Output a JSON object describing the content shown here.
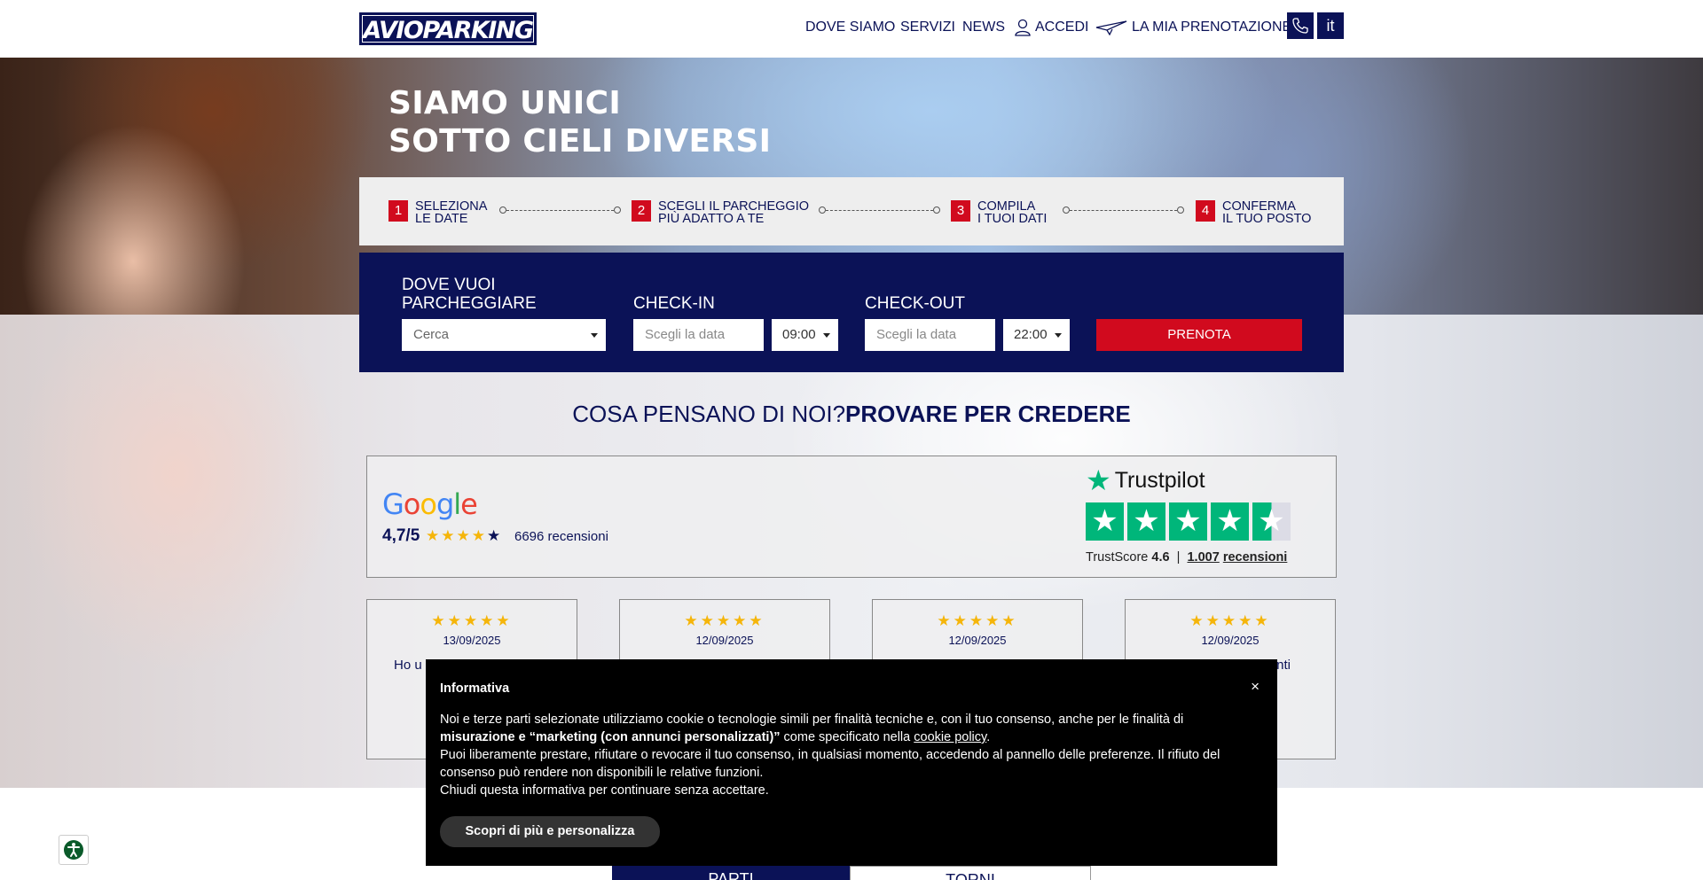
{
  "header": {
    "logo_text": "AVIOPARKING",
    "nav": {
      "where": "DOVE SIAMO",
      "services": "SERVIZI",
      "news": "NEWS",
      "login": "ACCEDI",
      "my_booking": "LA MIA PRENOTAZIONE"
    },
    "language": "it"
  },
  "hero": {
    "title_line1": "SIAMO UNICI",
    "title_line2": "SOTTO CIELI DIVERSI"
  },
  "steps": [
    {
      "num": "1",
      "line1": "SELEZIONA",
      "line2": "LE DATE"
    },
    {
      "num": "2",
      "line1": "SCEGLI IL PARCHEGGIO",
      "line2": "PIÙ ADATTO A TE"
    },
    {
      "num": "3",
      "line1": "COMPILA",
      "line2": "I TUOI DATI"
    },
    {
      "num": "4",
      "line1": "CONFERMA",
      "line2": "IL TUO POSTO"
    }
  ],
  "booking": {
    "where_label_line1": "DOVE VUOI",
    "where_label_line2": "PARCHEGGIARE",
    "where_value": "Cerca",
    "checkin_label": "CHECK-IN",
    "checkin_placeholder": "Scegli la data",
    "checkin_time": "09:00",
    "checkout_label": "CHECK-OUT",
    "checkout_placeholder": "Scegli la data",
    "checkout_time": "22:00",
    "submit": "PRENOTA"
  },
  "reviews": {
    "heading_part1": "COSA PENSANO DI NOI?",
    "heading_part2": "PROVARE PER CREDERE",
    "google": {
      "logo": "Google",
      "score": "4,7/5",
      "rating": 4.7,
      "count": "6696 recensioni"
    },
    "trustpilot": {
      "logo": "Trustpilot",
      "score_label": "TrustScore",
      "score": "4.6",
      "separator": "|",
      "count": "1.007",
      "count_label": "recensioni"
    },
    "cards": [
      {
        "date": "13/09/2025",
        "text": "Ho u servi be"
      },
      {
        "date": "12/09/2025",
        "text": ""
      },
      {
        "date": "12/09/2025",
        "text": ""
      },
      {
        "date": "12/09/2025",
        "text": "nti"
      }
    ]
  },
  "cookie": {
    "title": "Informativa",
    "close": "×",
    "p1_start": "Noi e terze parti selezionate utilizziamo cookie o tecnologie simili per finalità tecniche e, con il tuo consenso, anche per le finalità di ",
    "p1_bold": "misurazione e “marketing (con annunci personalizzati)”",
    "p1_mid": " come specificato nella ",
    "p1_link": "cookie policy",
    "p1_end": ".",
    "p2": "Puoi liberamente prestare, rifiutare o revocare il tuo consenso, in qualsiasi momento, accedendo al pannello delle preferenze. Il rifiuto del consenso può rendere non disponibili le relative funzioni.",
    "p3": "Chiudi questa informativa per continuare senza accettare.",
    "button": "Scopri di più e personalizza"
  },
  "tabs": {
    "active": "PARTI",
    "inactive": "TORNI"
  },
  "colors": {
    "brand_navy": "#0b1257",
    "brand_red": "#d10a1e",
    "trustpilot_green": "#00b67a",
    "star_yellow": "#f5b50a"
  }
}
